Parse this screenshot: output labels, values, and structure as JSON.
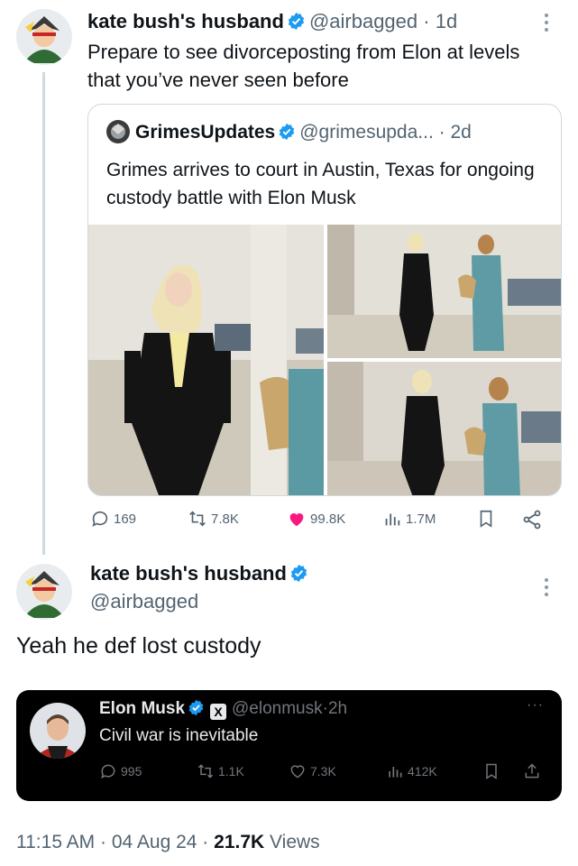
{
  "tweet1": {
    "display_name": "kate bush's husband",
    "handle": "@airbagged",
    "separator": "·",
    "time_ago": "1d",
    "text": "Prepare to see divorceposting from Elon at levels that you’ve never seen before"
  },
  "quote": {
    "display_name": "GrimesUpdates",
    "handle": "@grimesupda...",
    "separator": "·",
    "time_ago": "2d",
    "text": "Grimes arrives to court in Austin, Texas for ongoing custody battle with Elon Musk"
  },
  "stats": {
    "replies": "169",
    "reposts": "7.8K",
    "likes": "99.8K",
    "views": "1.7M"
  },
  "tweet2": {
    "display_name": "kate bush's husband",
    "handle": "@airbagged",
    "text": "Yeah he def lost custody"
  },
  "embedded": {
    "display_name": "Elon Musk",
    "handle": "@elonmusk",
    "separator": "·",
    "time_ago": "2h",
    "text": "Civil war is inevitable",
    "replies": "995",
    "reposts": "1.1K",
    "likes": "7.3K",
    "views": "412K",
    "more": "···"
  },
  "footer": {
    "time": "11:15 AM",
    "separator": "·",
    "date": "04 Aug 24",
    "separator2": "·",
    "views_count": "21.7K",
    "views_label": "Views"
  },
  "colors": {
    "verified_blue": "#1d9bf0",
    "like_pink": "#f91880",
    "text_secondary": "#536471",
    "border": "#cfd9de",
    "dark_bg": "#000000"
  },
  "icons": {
    "reply": "speech-bubble",
    "repost": "two-arrows-cycle",
    "like": "heart",
    "views": "bar-chart",
    "bookmark": "bookmark",
    "share": "share-nodes",
    "upload": "upload-arrow",
    "more": "vertical-dots"
  }
}
